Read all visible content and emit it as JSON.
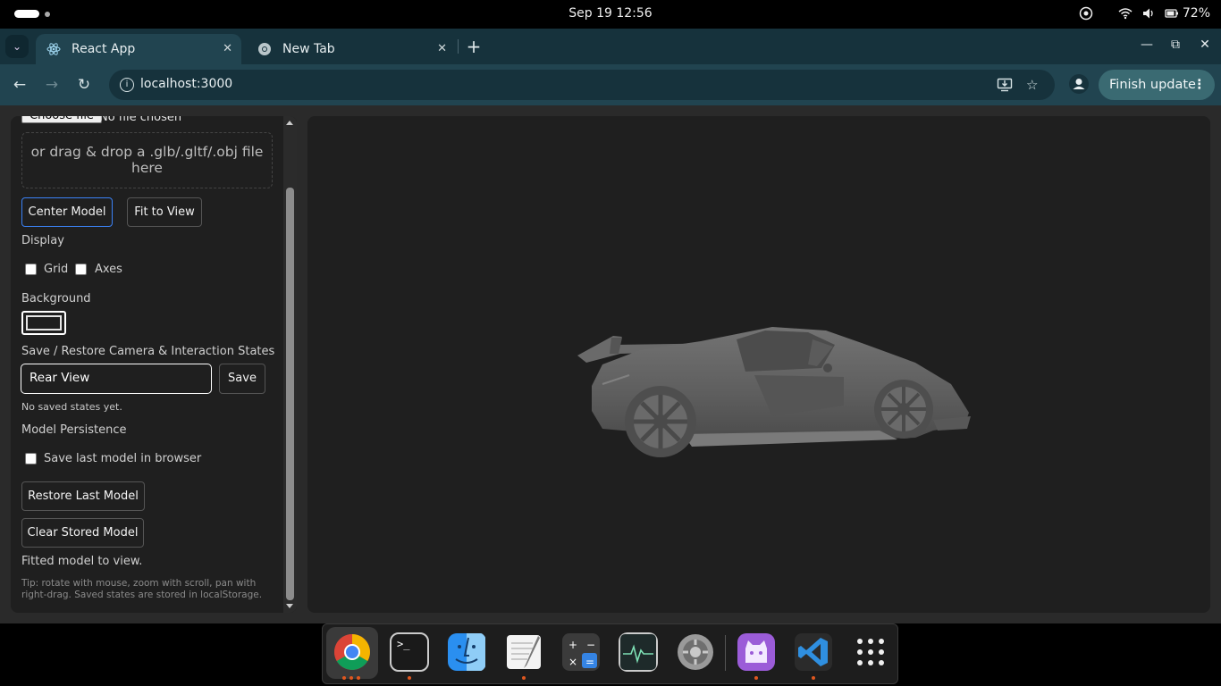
{
  "system": {
    "clock": "Sep 19  12:56",
    "battery": "72%"
  },
  "browser": {
    "tabs": [
      {
        "title": "React App",
        "active": true
      },
      {
        "title": "New Tab",
        "active": false
      }
    ],
    "url": "localhost:3000",
    "finish_update_label": "Finish update"
  },
  "panel": {
    "choose_file_label": "Choose file",
    "no_file_text": "No file chosen",
    "dropzone_text": "or drag & drop a .glb/.gltf/.obj file here",
    "center_model_label": "Center Model",
    "fit_to_view_label": "Fit to View",
    "display_heading": "Display",
    "grid_label": "Grid",
    "axes_label": "Axes",
    "background_heading": "Background",
    "background_color": "#1f1f1f",
    "states_heading": "Save / Restore Camera & Interaction States",
    "state_name_value": "Rear View",
    "save_label": "Save",
    "no_states_text": "No saved states yet.",
    "persistence_heading": "Model Persistence",
    "save_last_model_label": "Save last model in browser",
    "restore_last_label": "Restore Last Model",
    "clear_stored_label": "Clear Stored Model",
    "status_text": "Fitted model to view.",
    "tip_text": "Tip: rotate with mouse, zoom with scroll, pan with right-drag. Saved states are stored in localStorage."
  },
  "viewport": {
    "background_color": "#1f1f1f",
    "model_color": "#5e5e5e"
  },
  "dock": {
    "apps": [
      "chrome-icon",
      "terminal-icon",
      "finder-icon",
      "text-editor-icon",
      "calculator-icon",
      "system-monitor-icon",
      "settings-icon",
      "github-desktop-icon",
      "vscode-icon",
      "app-grid-icon"
    ]
  }
}
